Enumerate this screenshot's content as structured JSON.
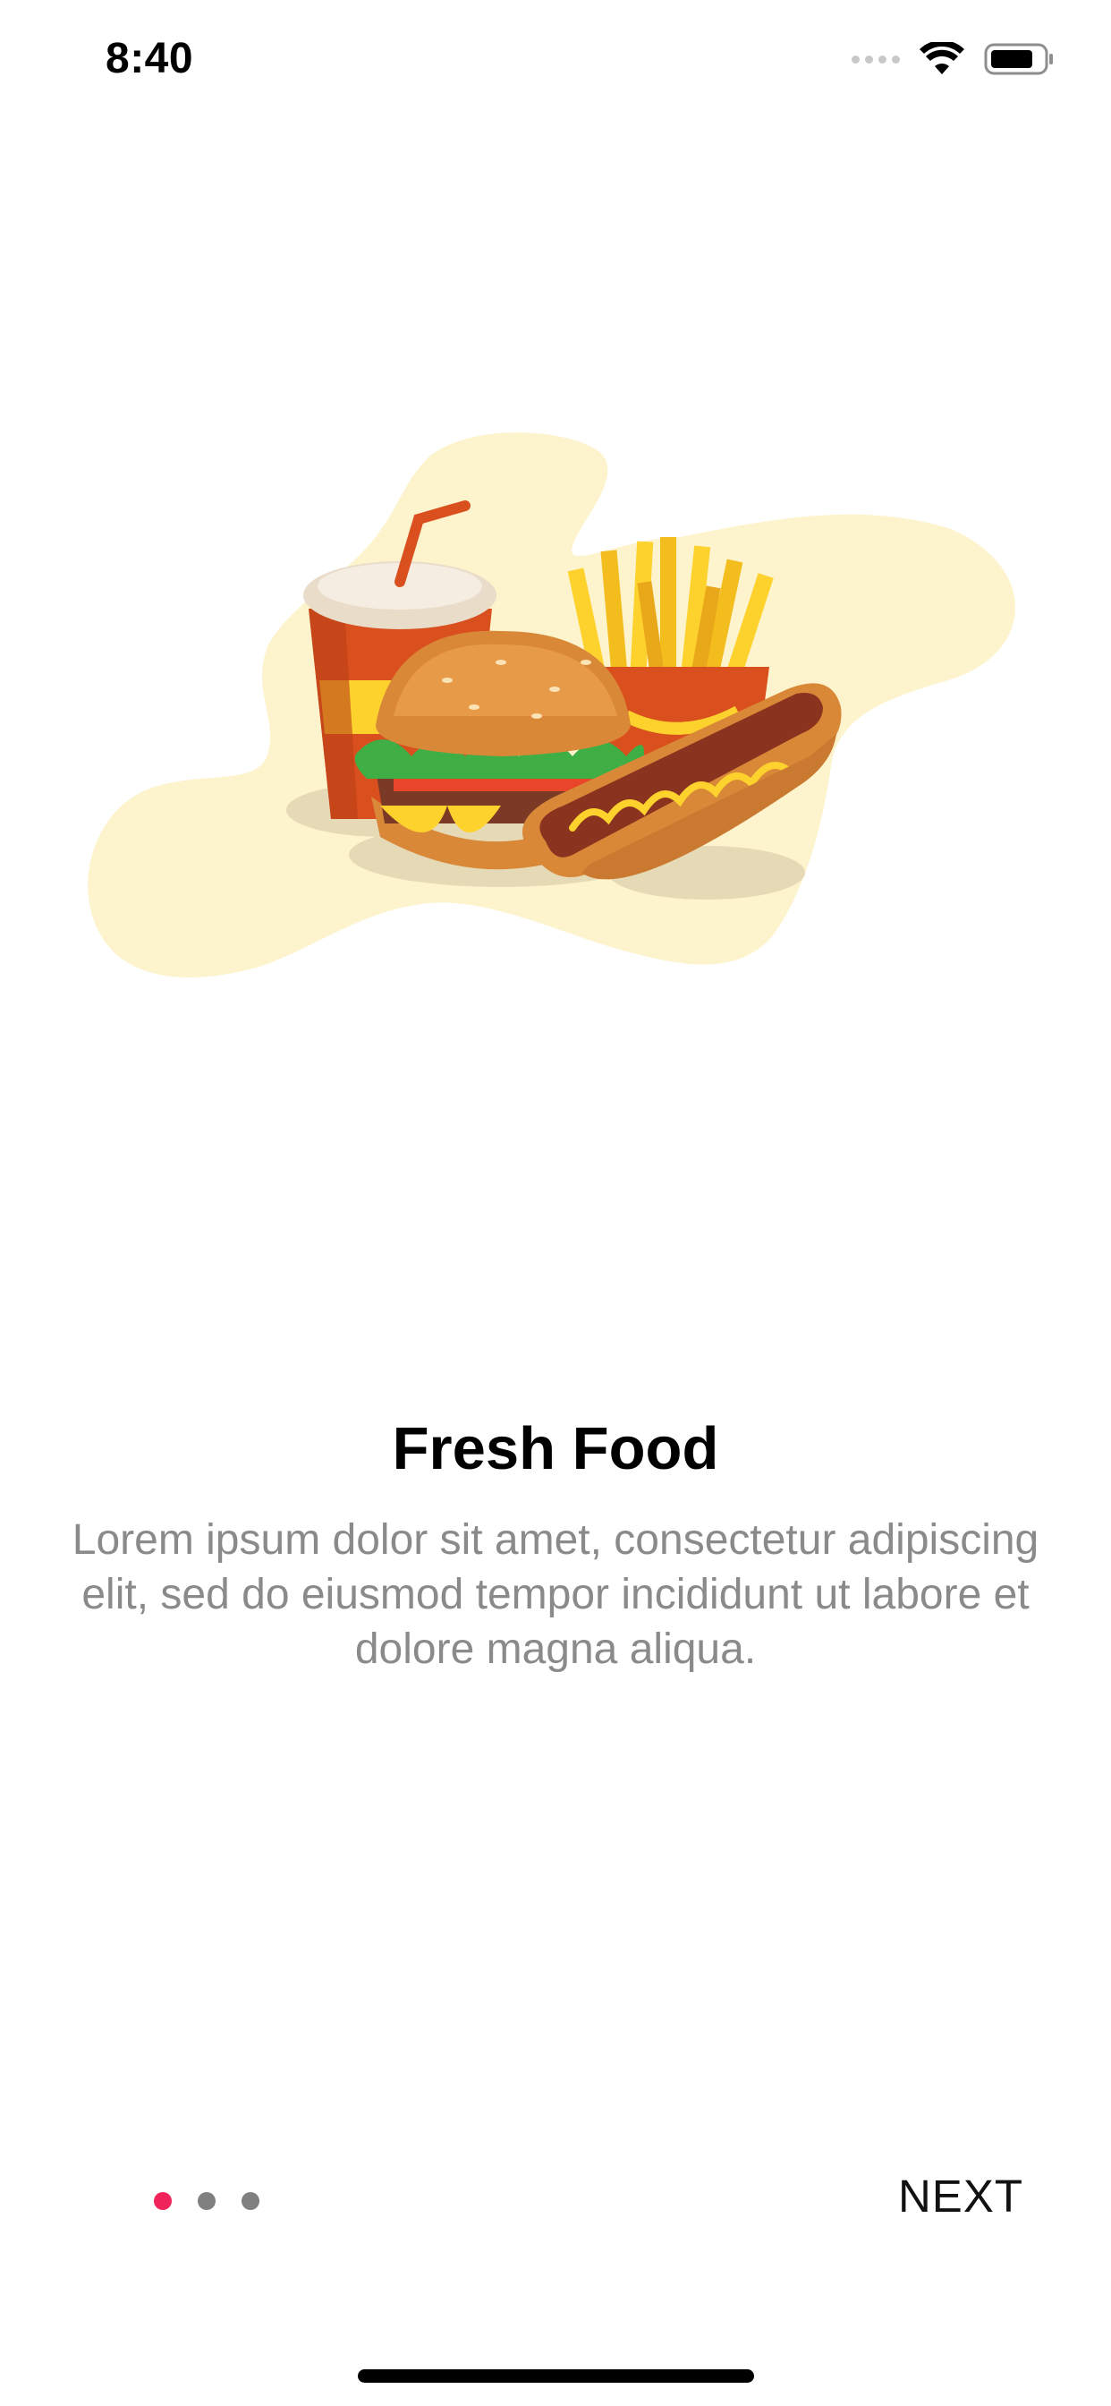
{
  "status_bar": {
    "time": "8:40",
    "icons": [
      "cellular-signal-icon",
      "wifi-icon",
      "battery-icon"
    ]
  },
  "onboarding": {
    "illustration": "fast-food-illustration",
    "title": "Fresh Food",
    "description": "Lorem ipsum dolor sit amet, consectetur adipiscing elit, sed do eiusmod tempor incididunt ut labore et dolore magna aliqua."
  },
  "pager": {
    "count": 3,
    "active_index": 0
  },
  "footer": {
    "next_label": "NEXT"
  },
  "colors": {
    "accent": "#f0245a",
    "inactive_dot": "#808080",
    "description_text": "#8a8a8a",
    "blob": "#fdf3cc"
  }
}
